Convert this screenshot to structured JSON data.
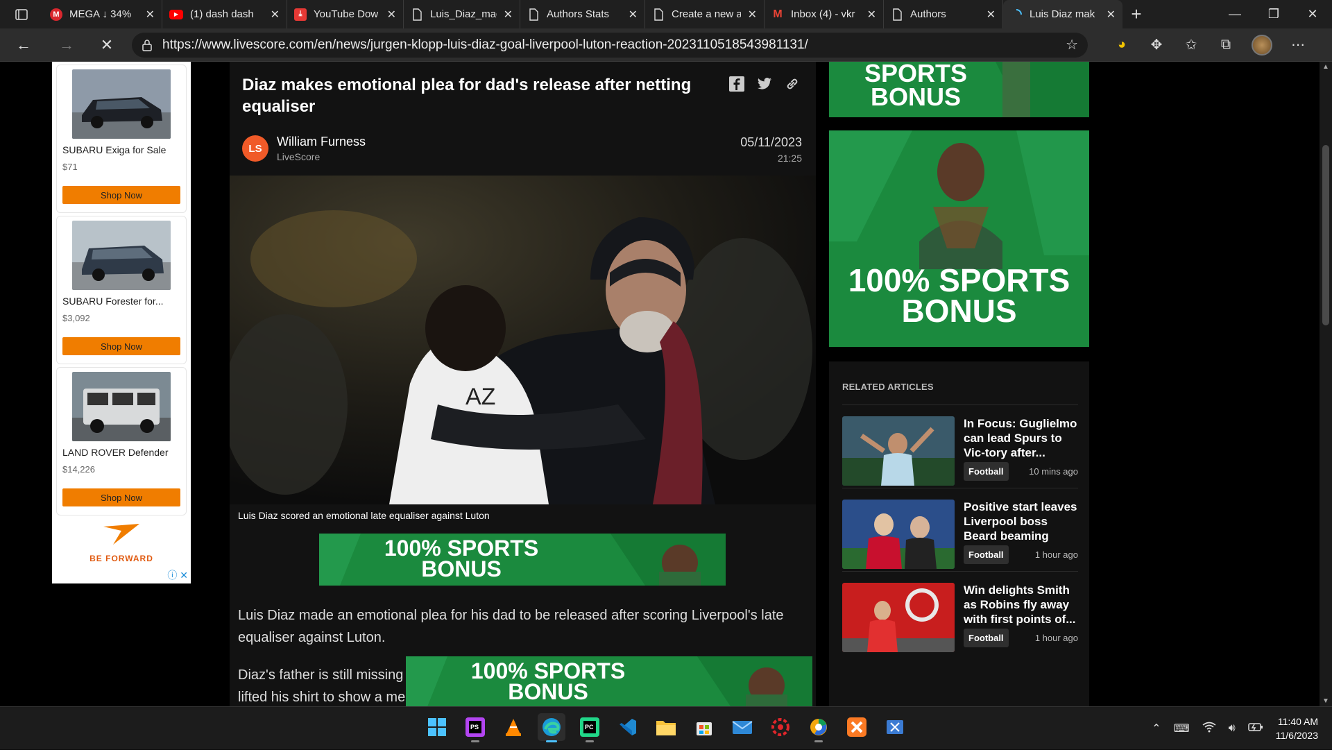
{
  "browser": {
    "tabs": [
      {
        "title": "MEGA ↓ 34%",
        "icon": "mega-icon",
        "color": "#d9272e"
      },
      {
        "title": "(1) dash dash",
        "icon": "youtube-icon",
        "color": "#ff0000"
      },
      {
        "title": "YouTube Dow",
        "icon": "download-icon",
        "color": "#e53935"
      },
      {
        "title": "Luis_Diaz_mad",
        "icon": "page-icon",
        "color": ""
      },
      {
        "title": "Authors Stats",
        "icon": "page-icon",
        "color": ""
      },
      {
        "title": "Create a new a",
        "icon": "page-icon",
        "color": ""
      },
      {
        "title": "Inbox (4) - vkr",
        "icon": "gmail-icon",
        "color": "#ea4335"
      },
      {
        "title": "Authors",
        "icon": "page-icon",
        "color": ""
      },
      {
        "title": "Luis Diaz mak",
        "icon": "loading-icon",
        "color": "#4cc2ff"
      }
    ],
    "url": "https://www.livescore.com/en/news/jurgen-klopp-luis-diaz-goal-liverpool-luton-reaction-20231105185439​81131/"
  },
  "left_ad": {
    "items": [
      {
        "name": "SUBARU Exiga for Sale",
        "price": "$71",
        "cta": "Shop Now"
      },
      {
        "name": "SUBARU Forester for...",
        "price": "$3,092",
        "cta": "Shop Now"
      },
      {
        "name": "LAND ROVER Defender",
        "price": "$14,226",
        "cta": "Shop Now"
      }
    ],
    "brand": "BE FORWARD"
  },
  "article": {
    "title": "Diaz makes emotional plea for dad's release after netting equaliser",
    "author_initials": "LS",
    "author": "William Furness",
    "source": "LiveScore",
    "date": "05/11/2023",
    "time": "21:25",
    "caption": "Luis Diaz scored an emotional late equaliser against Luton",
    "paragraph1": "Luis Diaz made an emotional plea for his dad to be released after scoring Liverpool's late equaliser against Luton.",
    "paragraph2_line1": "Diaz's father is still missing",
    "paragraph2_line2": "lifted his shirt to show a me"
  },
  "banners": {
    "line1": "100% SPORTS",
    "line2": "BONUS",
    "top_line1": "SPORTS",
    "top_line2": "BONUS"
  },
  "related": {
    "header": "RELATED ARTICLES",
    "items": [
      {
        "headline": "In Focus: Guglielmo can lead Spurs to Vic-tory after...",
        "tag": "Football",
        "ago": "10 mins ago"
      },
      {
        "headline": "Positive start leaves Liverpool boss Beard beaming",
        "tag": "Football",
        "ago": "1 hour ago"
      },
      {
        "headline": "Win delights Smith as Robins fly away with first points of...",
        "tag": "Football",
        "ago": "1 hour ago"
      }
    ]
  },
  "taskbar": {
    "time": "11:40 AM",
    "date": "11/6/2023"
  }
}
